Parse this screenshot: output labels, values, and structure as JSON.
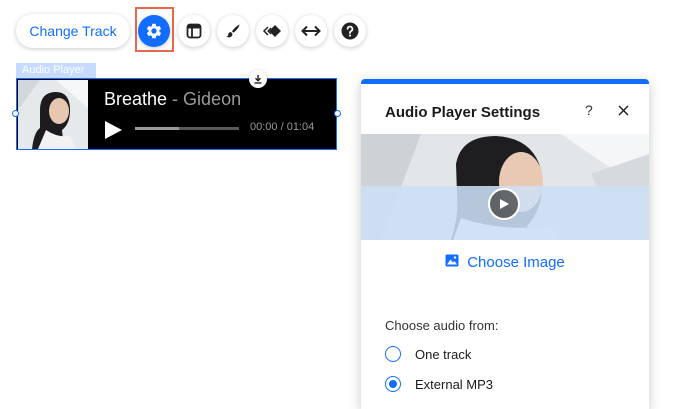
{
  "toolbar": {
    "change_track_label": "Change Track",
    "icons": [
      "gear-icon",
      "layout-icon",
      "brush-icon",
      "animation-icon",
      "stretch-icon",
      "help-icon"
    ]
  },
  "audio_player": {
    "tag_label": "Audio Player",
    "track_title": "Breathe",
    "separator": " - ",
    "artist": "Gideon",
    "time": "00:00 / 01:04",
    "progress": 0.42
  },
  "settings_panel": {
    "title": "Audio Player Settings",
    "help_label": "?",
    "choose_image_label": "Choose Image",
    "section_label": "Choose audio from:",
    "options": [
      {
        "label": "One track",
        "checked": false
      },
      {
        "label": "External MP3",
        "checked": true
      }
    ]
  },
  "colors": {
    "accent": "#116dff",
    "highlight_outline": "#e8684a",
    "player_bg": "#000000",
    "muted_text": "#9a9a9a"
  }
}
